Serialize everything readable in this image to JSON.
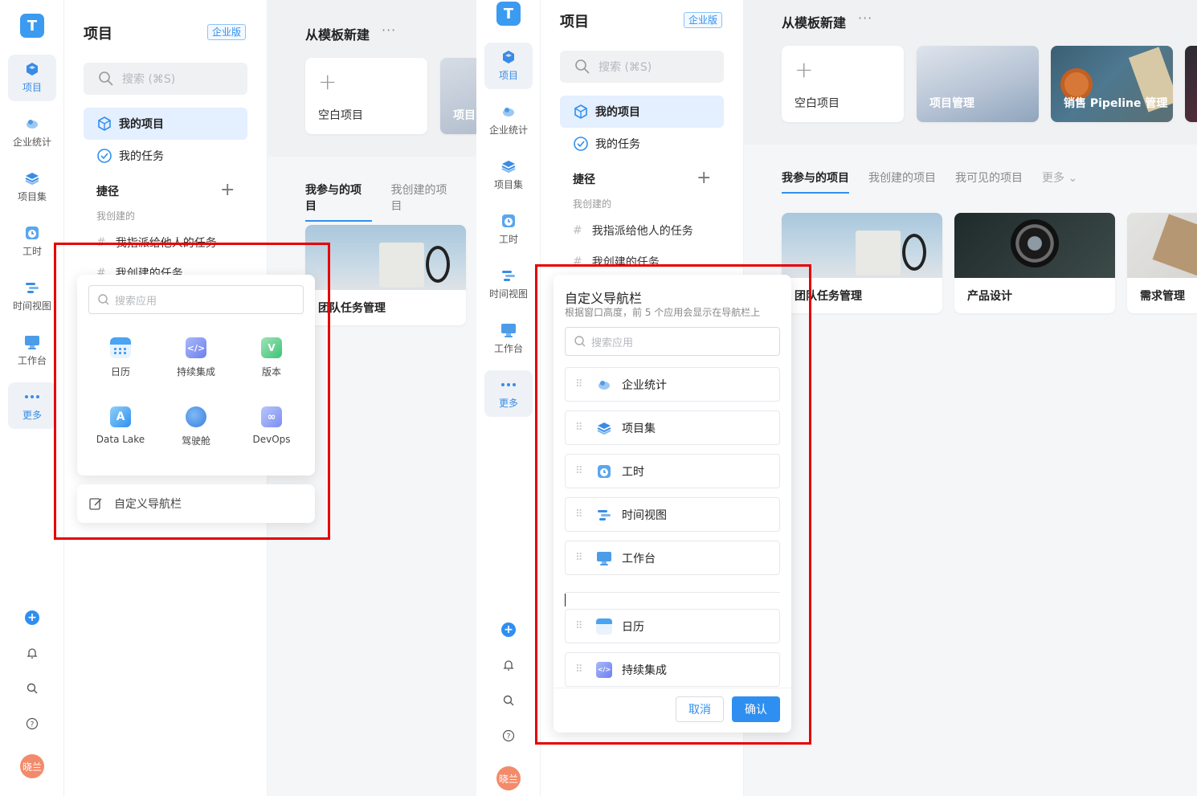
{
  "colors": {
    "accent": "#2f8ff0",
    "highlight_border": "#e60000",
    "active_bg": "#e4efff"
  },
  "left": {
    "rail": {
      "items": [
        {
          "label": "项目",
          "icon": "project-cube-icon",
          "active": true
        },
        {
          "label": "企业统计",
          "icon": "enterprise-stats-icon"
        },
        {
          "label": "项目集",
          "icon": "project-set-icon"
        },
        {
          "label": "工时",
          "icon": "timesheet-icon"
        },
        {
          "label": "时间视图",
          "icon": "timeline-icon"
        },
        {
          "label": "工作台",
          "icon": "workbench-icon"
        },
        {
          "label": "更多",
          "icon": "more-dots-icon",
          "active": true
        }
      ],
      "avatar": "晓兰"
    },
    "sidebar": {
      "title": "项目",
      "badge": "企业版",
      "search_placeholder": "搜索 (⌘S)",
      "nav": [
        {
          "label": "我的项目"
        },
        {
          "label": "我的任务"
        }
      ],
      "shortcut_title": "捷径",
      "created_label": "我创建的",
      "shortcuts": [
        {
          "label": "我指派给他人的任务"
        },
        {
          "label": "我创建的任务"
        }
      ]
    },
    "main": {
      "template_title": "从模板新建",
      "templates": [
        {
          "label": "空白项目"
        },
        {
          "label": "项目"
        }
      ],
      "tabs": [
        {
          "label": "我参与的项目"
        },
        {
          "label": "我创建的项目"
        }
      ],
      "projects": [
        {
          "label": "团队任务管理"
        }
      ]
    },
    "apps_popover": {
      "search_placeholder": "搜索应用",
      "apps": [
        {
          "label": "日历",
          "icon": "calendar-icon"
        },
        {
          "label": "持续集成",
          "icon": "ci-icon"
        },
        {
          "label": "版本",
          "icon": "version-icon"
        },
        {
          "label": "Data Lake",
          "icon": "data-lake-icon"
        },
        {
          "label": "驾驶舱",
          "icon": "cockpit-icon"
        },
        {
          "label": "DevOps",
          "icon": "devops-icon"
        }
      ],
      "customize_label": "自定义导航栏"
    }
  },
  "right": {
    "rail": {
      "items": [
        {
          "label": "项目",
          "active": true
        },
        {
          "label": "企业统计"
        },
        {
          "label": "项目集"
        },
        {
          "label": "工时"
        },
        {
          "label": "时间视图"
        },
        {
          "label": "工作台"
        },
        {
          "label": "更多",
          "active": true
        }
      ],
      "avatar": "晓兰"
    },
    "sidebar": {
      "title": "项目",
      "badge": "企业版",
      "search_placeholder": "搜索 (⌘S)",
      "nav": [
        {
          "label": "我的项目"
        },
        {
          "label": "我的任务"
        }
      ],
      "shortcut_title": "捷径",
      "created_label": "我创建的",
      "shortcuts": [
        {
          "label": "我指派给他人的任务"
        },
        {
          "label": "我创建的任务"
        }
      ]
    },
    "main": {
      "template_title": "从模板新建",
      "templates": [
        {
          "label": "空白项目"
        },
        {
          "label": "项目管理"
        },
        {
          "label": "销售 Pipeline 管理"
        }
      ],
      "tabs": [
        {
          "label": "我参与的项目"
        },
        {
          "label": "我创建的项目"
        },
        {
          "label": "我可见的项目"
        },
        {
          "label": "更多"
        }
      ],
      "projects": [
        {
          "label": "团队任务管理"
        },
        {
          "label": "产品设计"
        },
        {
          "label": "需求管理"
        }
      ]
    },
    "customize_dialog": {
      "title": "自定义导航栏",
      "subtitle": "根据窗口高度，前 5 个应用会显示在导航栏上",
      "search_placeholder": "搜索应用",
      "pinned": [
        {
          "label": "企业统计",
          "icon": "enterprise-stats-icon"
        },
        {
          "label": "项目集",
          "icon": "project-set-icon"
        },
        {
          "label": "工时",
          "icon": "timesheet-icon"
        },
        {
          "label": "时间视图",
          "icon": "timeline-icon"
        },
        {
          "label": "工作台",
          "icon": "workbench-icon"
        }
      ],
      "others": [
        {
          "label": "日历",
          "icon": "calendar-icon"
        },
        {
          "label": "持续集成",
          "icon": "ci-icon"
        }
      ],
      "cancel_label": "取消",
      "confirm_label": "确认"
    }
  }
}
